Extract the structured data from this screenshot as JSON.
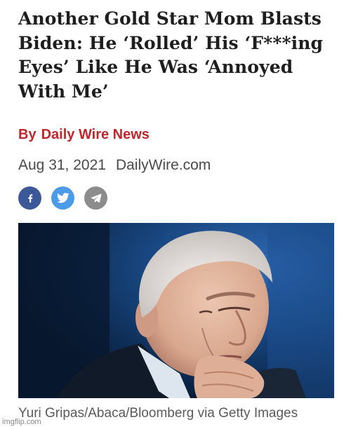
{
  "article": {
    "headline_lines": [
      "Another Gold Star Mom Blasts",
      "Biden: He ‘Rolled’ His ‘F***ing",
      "Eyes’ Like He Was ‘Annoyed",
      "With Me’"
    ],
    "byline_prefix": "By",
    "author": "Daily Wire News",
    "date": "Aug 31, 2021",
    "source": "DailyWire.com",
    "photo_credit": "Yuri Gripas/Abaca/Bloomberg via Getty Images"
  },
  "share": {
    "buttons": [
      {
        "name": "facebook",
        "icon": "facebook-icon",
        "color": "#3b5998"
      },
      {
        "name": "twitter",
        "icon": "twitter-icon",
        "color": "#4b9be8"
      },
      {
        "name": "telegram",
        "icon": "telegram-icon",
        "color": "#8c8c8c"
      }
    ]
  },
  "colors": {
    "headline": "#1e1e1e",
    "byline": "#c0272d",
    "meta": "#4a4a4a",
    "photo_background": "#0c2b52"
  },
  "watermark": "imgflip.com"
}
